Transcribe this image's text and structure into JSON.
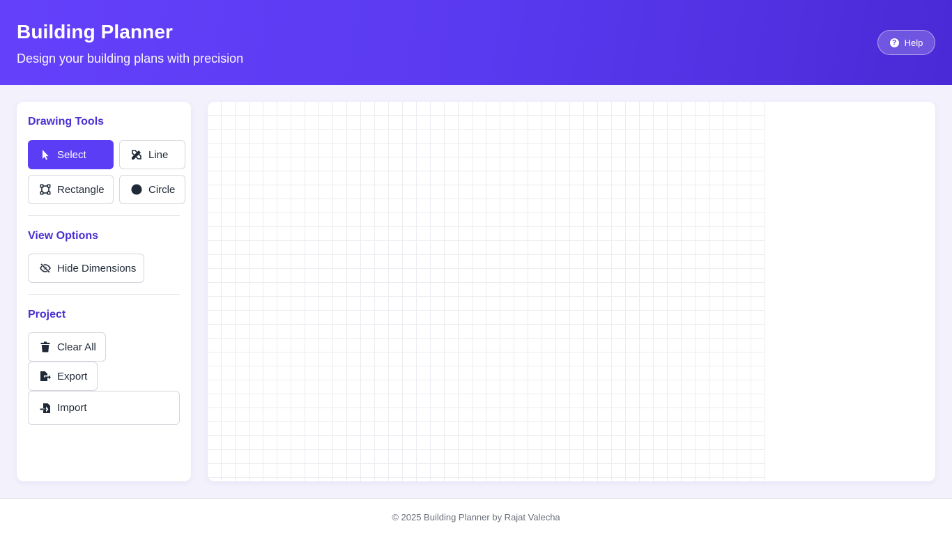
{
  "header": {
    "title": "Building Planner",
    "subtitle": "Design your building plans with precision",
    "help_label": "Help",
    "help_icon": "question-circle-icon"
  },
  "sidebar": {
    "drawing_tools": {
      "title": "Drawing Tools",
      "tools": [
        {
          "label": "Select",
          "icon": "cursor-icon",
          "active": true
        },
        {
          "label": "Line",
          "icon": "pencil-ruler-icon",
          "active": false
        },
        {
          "label": "Rectangle",
          "icon": "vector-square-icon",
          "active": false
        },
        {
          "label": "Circle",
          "icon": "circle-icon",
          "active": false
        }
      ]
    },
    "view_options": {
      "title": "View Options",
      "hide_dimensions_label": "Hide Dimensions",
      "hide_dimensions_icon": "eye-slash-icon"
    },
    "project": {
      "title": "Project",
      "clear_all_label": "Clear All",
      "clear_all_icon": "trash-icon",
      "export_label": "Export",
      "export_icon": "file-export-icon",
      "import_label": "Import",
      "import_icon": "file-import-icon"
    }
  },
  "footer": {
    "text": "© 2025 Building Planner by Rajat Valecha"
  },
  "colors": {
    "accent": "#5b3df5",
    "header_gradient_start": "#6440fb",
    "header_gradient_end": "#4a2ad6",
    "section_title": "#4b2fd0",
    "page_background": "#f3f1fc"
  }
}
